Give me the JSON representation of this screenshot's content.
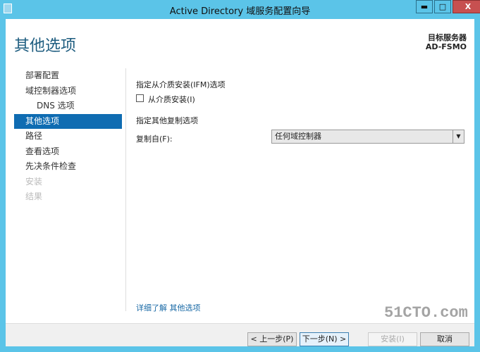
{
  "window": {
    "title": "Active Directory 域服务配置向导",
    "minimize": "▬",
    "maximize": "□",
    "close": "X"
  },
  "header": {
    "title": "其他选项",
    "target_label": "目标服务器",
    "target_server": "AD-FSMO"
  },
  "nav": [
    {
      "label": "部署配置"
    },
    {
      "label": "域控制器选项"
    },
    {
      "label": "DNS 选项"
    },
    {
      "label": "其他选项"
    },
    {
      "label": "路径"
    },
    {
      "label": "查看选项"
    },
    {
      "label": "先决条件检查"
    },
    {
      "label": "安装"
    },
    {
      "label": "结果"
    }
  ],
  "main": {
    "ifm_section": "指定从介质安装(IFM)选项",
    "ifm_checkbox": "从介质安装(I)",
    "repl_section": "指定其他复制选项",
    "repl_label": "复制自(F):",
    "repl_value": "任何域控制器",
    "learn_more": "详细了解 其他选项"
  },
  "footer": {
    "prev": "< 上一步(P)",
    "next": "下一步(N) >",
    "install": "安装(I)",
    "cancel": "取消"
  },
  "watermark": "51CTO.com"
}
